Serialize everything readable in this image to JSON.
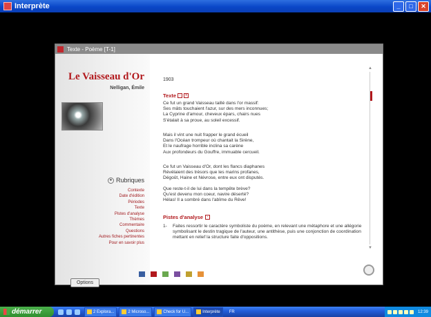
{
  "window": {
    "title": "Interprète",
    "buttons": [
      "_",
      "□",
      "✕"
    ]
  },
  "app": {
    "header": "Texte - Poème [T-1]",
    "poem_title": "Le Vaisseau d'Or",
    "author": "Nelligan, Émile",
    "year": "1903",
    "texte_heading": "Texte",
    "stanzas": [
      [
        "Ce fut un grand Vaisseau taillé dans l'or massif:",
        "Ses mâts touchaient l'azur, sur des mers inconnues;",
        "La Cyprine d'amour, cheveux épars, chairs nues",
        "S'étalait à sa proue, au soleil excessif."
      ],
      [
        "Mais il vint une nuit frapper le grand écueil",
        "Dans l'Océan trompeur où chantait la Sirène,",
        "Et le naufrage horrible inclina sa carène",
        "Aux profondeurs du Gouffre, immuable cercueil."
      ],
      [
        "Ce fut un Vaisseau d'Or, dont les flancs diaphanes",
        "Révélaient des trésors que les marins profanes,",
        "Dégoût, Haine et Névrose, entre eux ont disputés."
      ],
      [
        "Que reste-t-il de lui dans la tempête brève?",
        "Qu'est devenu mon coeur, navire déserté?",
        "Hélas! Il a sombré dans l'abîme du Rêve!"
      ]
    ],
    "pistes_heading": "Pistes d'analyse",
    "pistes": [
      {
        "num": "1-",
        "text": "Faites ressortir le caractère symboliste du poème, en relevant une métaphore et une allégorie symbolisant le destin tragique de l'auteur, une antithèse, puis une conjonction de coordination mettant en relief la structure faite d'oppositions."
      }
    ],
    "rubriques_heading": "Rubriques",
    "rubriques": [
      "Contexte",
      "Date d'édition",
      "Périodes",
      "Texte",
      "Pistes d'analyse",
      "Thèmes",
      "Commentaire",
      "Questions",
      "Autres fiches pertinentes",
      "Pour en savoir plus"
    ],
    "options_label": "Options",
    "swatch_colors": [
      "#3a5fa0",
      "#b1181c",
      "#6aa84f",
      "#7b4fa0",
      "#c0a030",
      "#e69138"
    ]
  },
  "taskbar": {
    "start_label": "démarrer",
    "tasks": [
      "2 Explora...",
      "2 Microso...",
      "Check for U...",
      "Interprète"
    ],
    "language": "FR",
    "clock": "12:39"
  }
}
